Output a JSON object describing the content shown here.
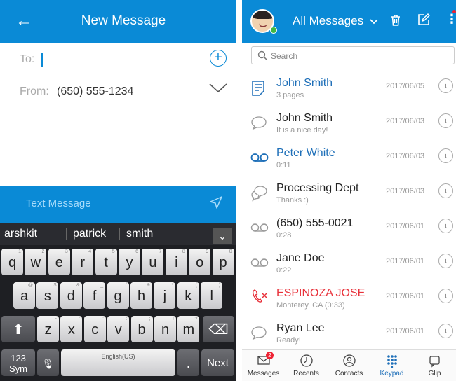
{
  "left": {
    "header": {
      "back_icon": "arrow-left-icon",
      "title": "New Message"
    },
    "to": {
      "label": "To:",
      "value": ""
    },
    "from": {
      "label": "From:",
      "value": "(650) 555-1234"
    },
    "text_message": {
      "placeholder": "Text Message"
    },
    "keyboard": {
      "suggestions": [
        "arshkit",
        "patrick",
        "smith"
      ],
      "row1": [
        {
          "k": "q",
          "s": "1"
        },
        {
          "k": "w",
          "s": "2"
        },
        {
          "k": "e",
          "s": "3"
        },
        {
          "k": "r",
          "s": "4"
        },
        {
          "k": "t",
          "s": "5"
        },
        {
          "k": "y",
          "s": "6"
        },
        {
          "k": "u",
          "s": "7"
        },
        {
          "k": "i",
          "s": "8"
        },
        {
          "k": "o",
          "s": "9"
        },
        {
          "k": "p",
          "s": "0"
        }
      ],
      "row2": [
        {
          "k": "a",
          "s": "@"
        },
        {
          "k": "s",
          "s": "$"
        },
        {
          "k": "d",
          "s": "&"
        },
        {
          "k": "f",
          "s": "_"
        },
        {
          "k": "g",
          "s": "/"
        },
        {
          "k": "h",
          "s": "&"
        },
        {
          "k": "j",
          "s": "*"
        },
        {
          "k": "k",
          "s": "("
        },
        {
          "k": "l",
          "s": ")"
        }
      ],
      "row3": [
        {
          "k": "z",
          "s": "-"
        },
        {
          "k": "x",
          "s": "'"
        },
        {
          "k": "c",
          "s": "\""
        },
        {
          "k": "v",
          "s": ":"
        },
        {
          "k": "b",
          "s": ";"
        },
        {
          "k": "n",
          "s": "!"
        },
        {
          "k": "m",
          "s": "?"
        }
      ],
      "sym": "123\nSym",
      "space": "English(US)",
      "period": ".",
      "next": "Next"
    }
  },
  "right": {
    "header": {
      "title": "All Messages"
    },
    "search": {
      "placeholder": "Search"
    },
    "messages": [
      {
        "name": "John Smith",
        "sub": "3 pages",
        "date": "2017/06/05",
        "type": "fax",
        "color": "#1e6fb8"
      },
      {
        "name": "John Smith",
        "sub": "It is a nice day!",
        "date": "2017/06/03",
        "type": "text",
        "color": "#222222"
      },
      {
        "name": "Peter White",
        "sub": "0:11",
        "date": "2017/06/03",
        "type": "voicemail-unread",
        "color": "#1e6fb8"
      },
      {
        "name": "Processing Dept",
        "sub": "Thanks :)",
        "date": "2017/06/03",
        "type": "group-text",
        "color": "#222222"
      },
      {
        "name": "(650) 555-0021",
        "sub": "0:28",
        "date": "2017/06/01",
        "type": "voicemail",
        "color": "#222222"
      },
      {
        "name": "Jane Doe",
        "sub": "0:22",
        "date": "2017/06/01",
        "type": "voicemail",
        "color": "#222222"
      },
      {
        "name": "ESPINOZA JOSE",
        "sub": "Monterey, CA (0:33)",
        "date": "2017/06/01",
        "type": "missed-call",
        "color": "#e8313a"
      },
      {
        "name": "Ryan Lee",
        "sub": "Ready!",
        "date": "2017/06/01",
        "type": "text",
        "color": "#222222"
      }
    ],
    "tabs": [
      {
        "label": "Messages",
        "icon": "envelope-icon",
        "badge": "2",
        "active": false
      },
      {
        "label": "Recents",
        "icon": "clock-icon",
        "active": false
      },
      {
        "label": "Contacts",
        "icon": "contacts-icon",
        "active": false
      },
      {
        "label": "Keypad",
        "icon": "keypad-icon",
        "active": true
      },
      {
        "label": "Glip",
        "icon": "glip-icon",
        "active": false
      }
    ],
    "colors": {
      "brand": "#0a8ad6",
      "active_tab": "#1e6fb8",
      "missed": "#e8313a"
    }
  }
}
